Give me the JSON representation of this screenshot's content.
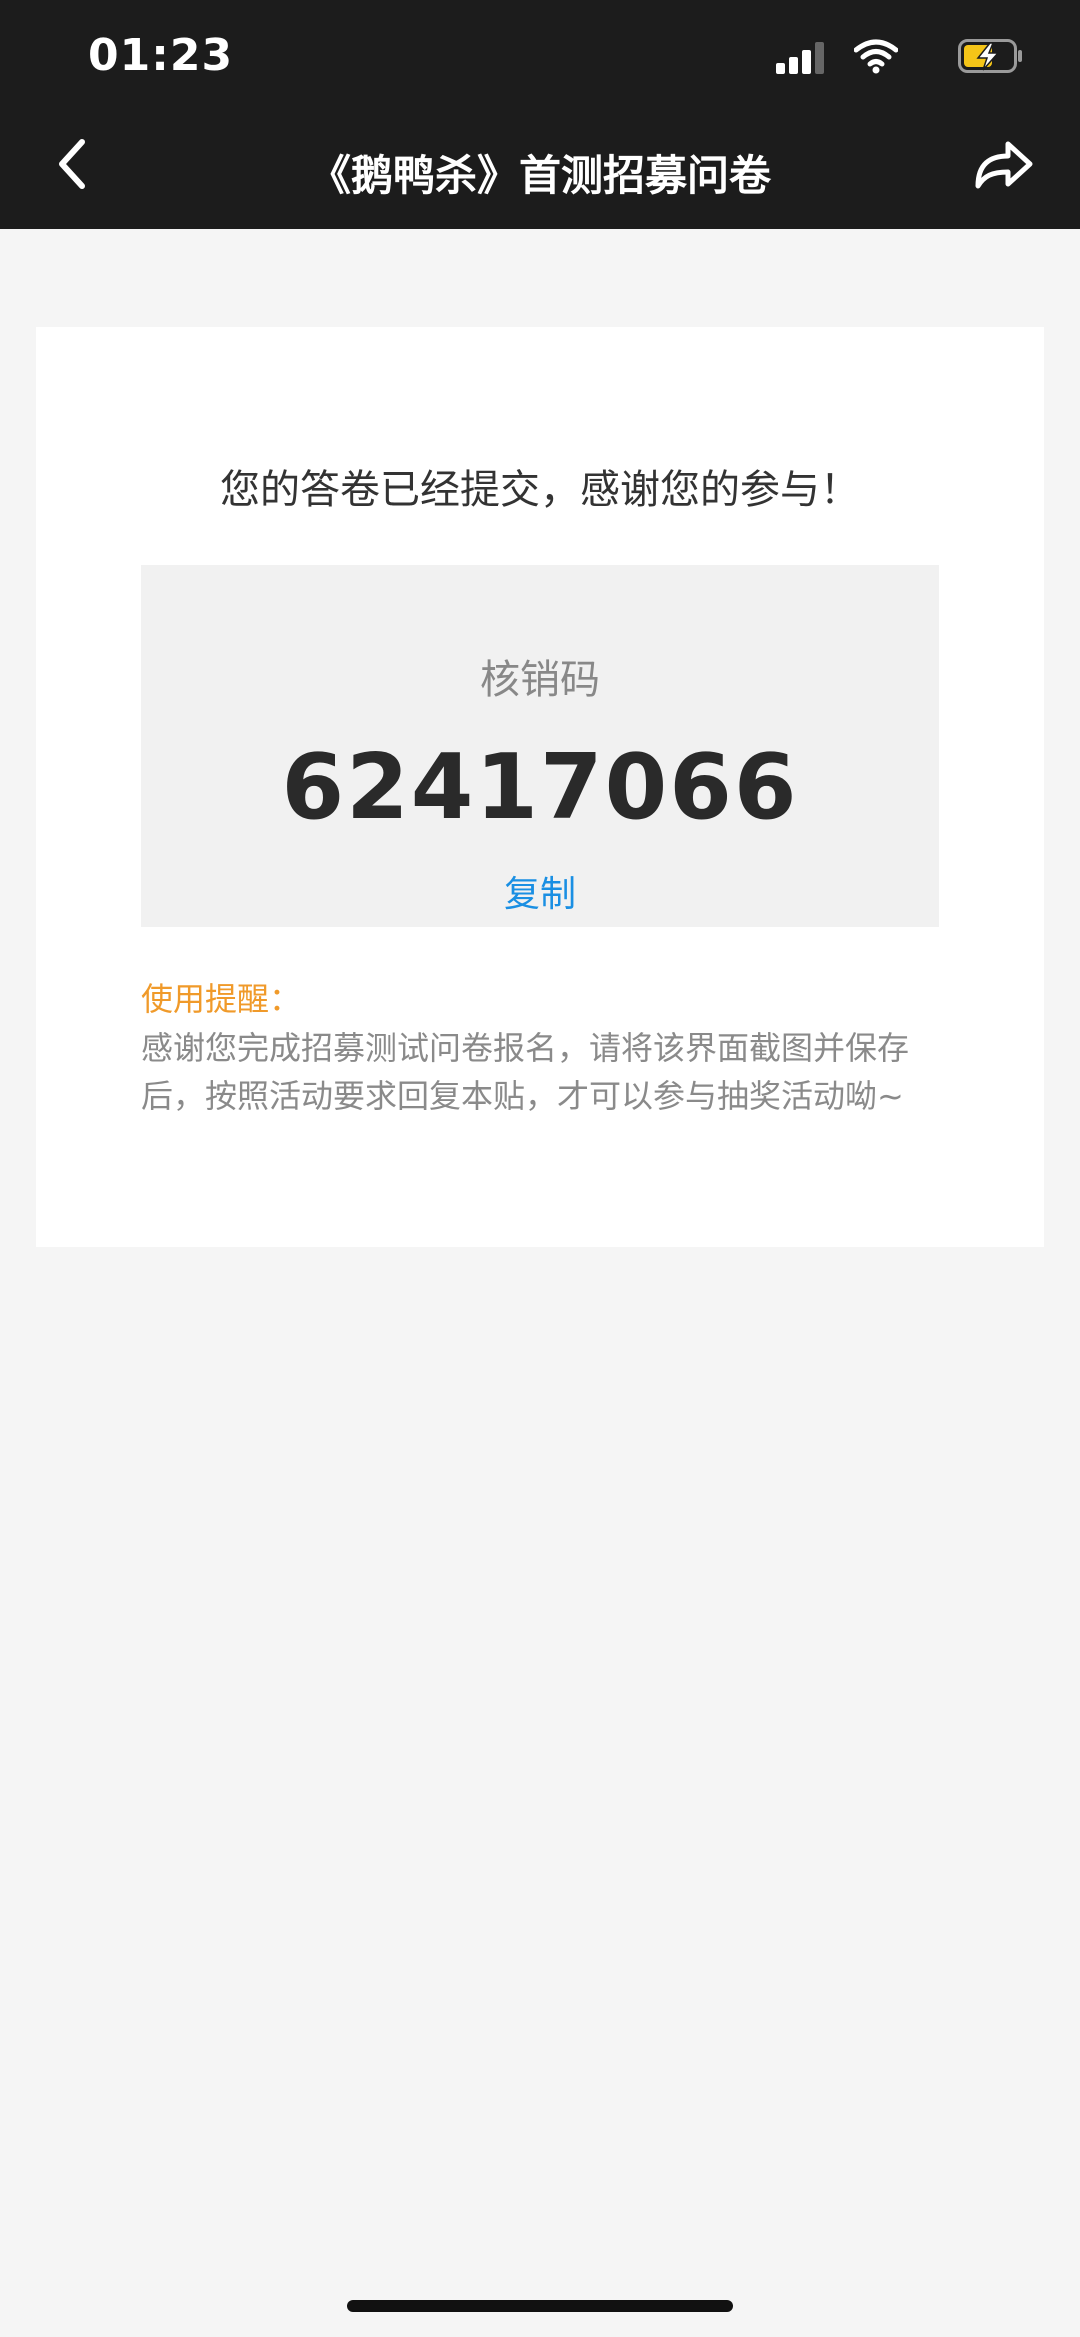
{
  "status_bar": {
    "time": "01:23",
    "icons": [
      "signal-icon",
      "wifi-icon",
      "battery-charging-icon"
    ],
    "battery_color": "#f5c518"
  },
  "nav": {
    "title": "《鹅鸭杀》首测招募问卷",
    "back_icon": "chevron-left-icon",
    "share_icon": "share-arrow-icon"
  },
  "result": {
    "message": "您的答卷已经提交，感谢您的参与！",
    "code_label": "核销码",
    "code_value": "62417066",
    "copy_label": "复制"
  },
  "reminder": {
    "title": "使用提醒：",
    "text": "感谢您完成招募测试问卷报名，请将该界面截图并保存后，按照活动要求回复本贴，才可以参与抽奖活动呦~"
  },
  "colors": {
    "accent_link": "#1a8fe3",
    "reminder_title": "#f09a2a",
    "header_bg": "#1c1c1c"
  }
}
